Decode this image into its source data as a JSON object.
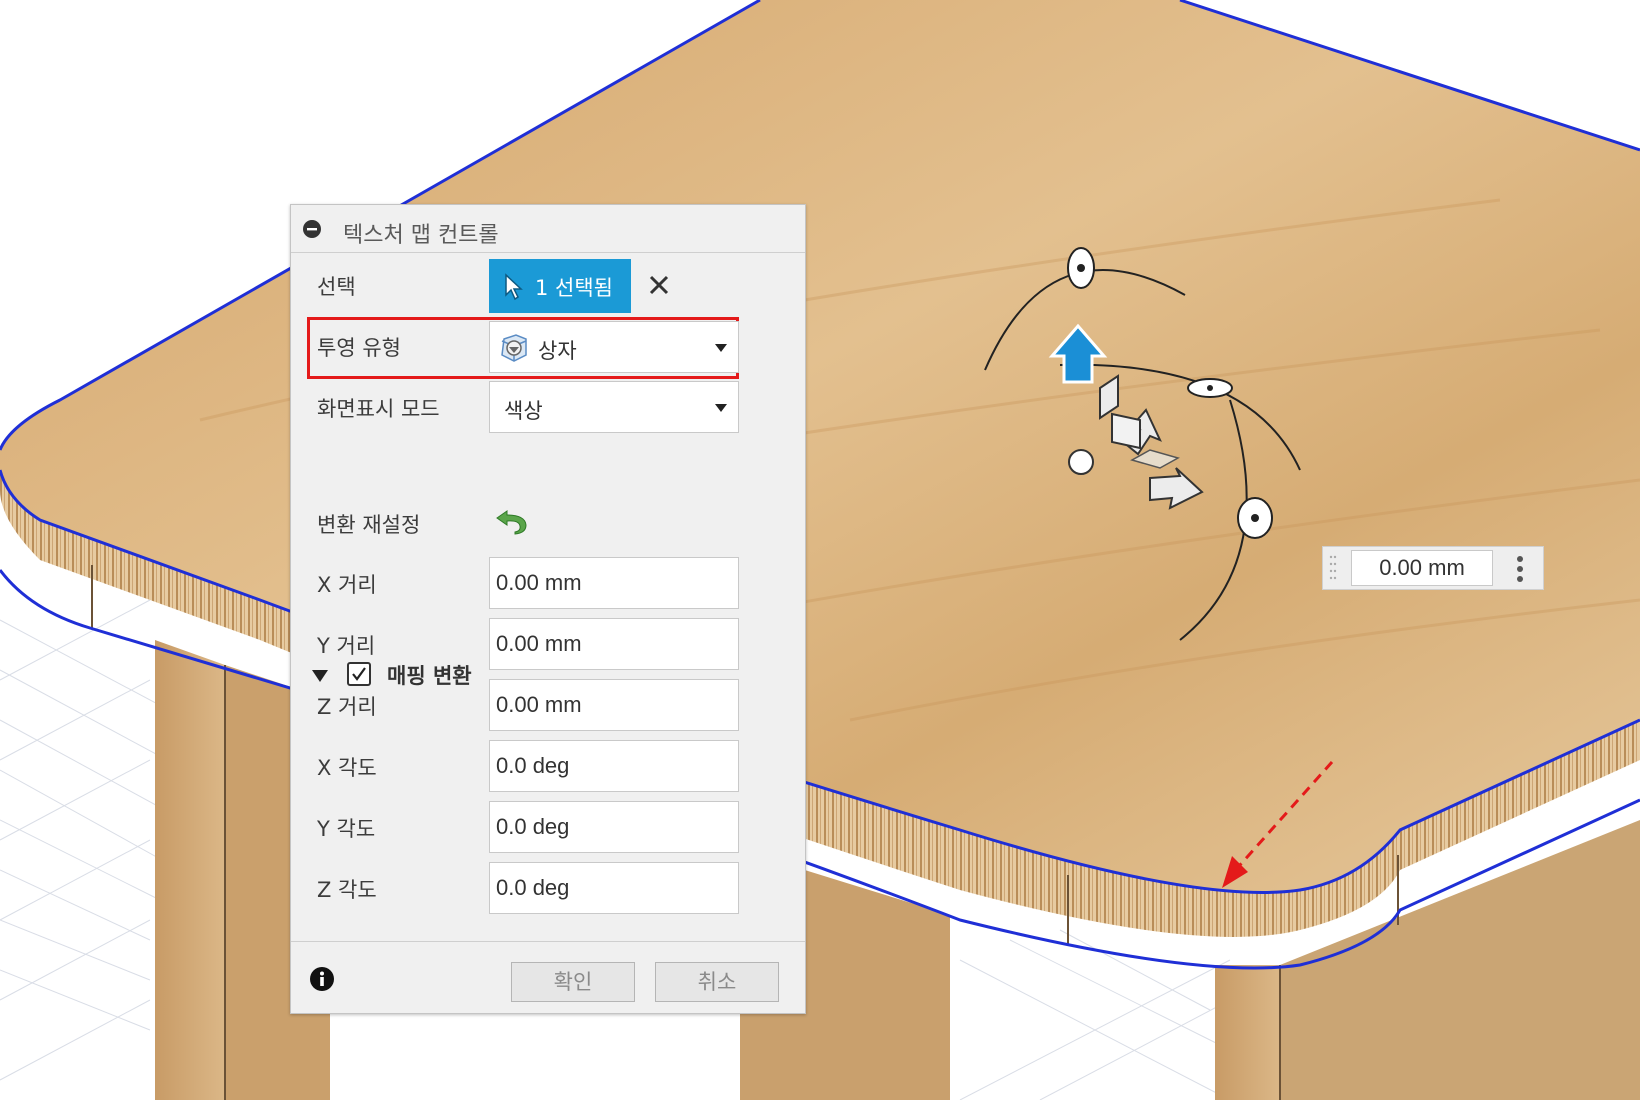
{
  "dialog": {
    "title": "텍스처 맵 컨트롤",
    "select_label": "선택",
    "select_button": "1 선택됨",
    "projection_label": "투영 유형",
    "projection_value": "상자",
    "display_mode_label": "화면표시 모드",
    "display_mode_value": "색상",
    "mapping_section": "매핑 변환",
    "mapping_checked": true,
    "reset_label": "변환 재설정",
    "fields": [
      {
        "label": "X 거리",
        "value": "0.00 mm"
      },
      {
        "label": "Y 거리",
        "value": "0.00 mm"
      },
      {
        "label": "Z 거리",
        "value": "0.00 mm"
      },
      {
        "label": "X 각도",
        "value": "0.0 deg"
      },
      {
        "label": "Y 각도",
        "value": "0.0 deg"
      },
      {
        "label": "Z 각도",
        "value": "0.0 deg"
      }
    ],
    "ok_button": "확인",
    "cancel_button": "취소"
  },
  "floating_input": {
    "value": "0.00 mm"
  },
  "colors": {
    "accent": "#1b9ad6",
    "highlight": "#e41a1a",
    "wood": "#d9b27d",
    "edge": "#1f2fd6",
    "manipulator_arrow": "#1b8fd6"
  }
}
